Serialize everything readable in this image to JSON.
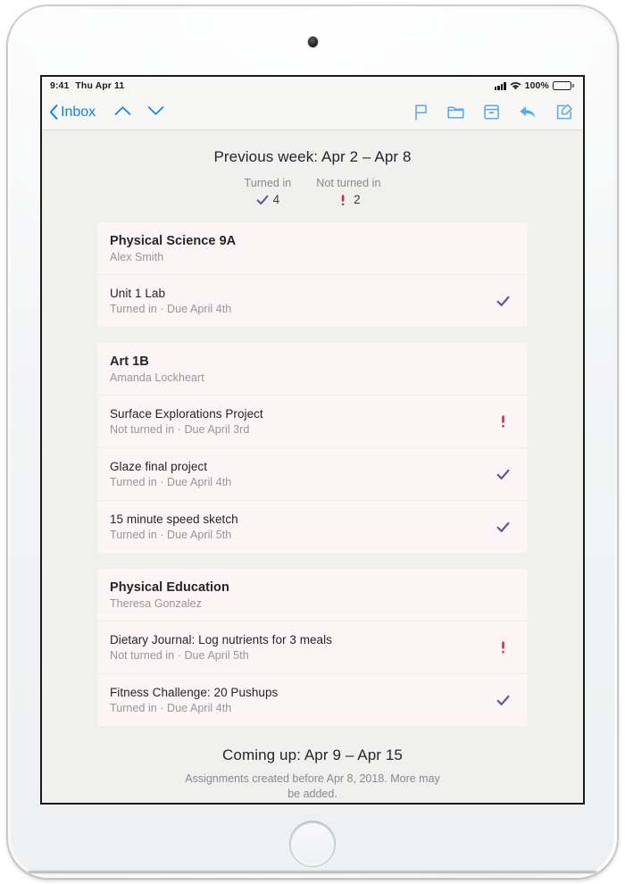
{
  "status_bar": {
    "time": "9:41",
    "date": "Thu Apr 11",
    "battery_percent": "100%",
    "signal_icon": "cellular-signal-icon",
    "wifi_icon": "wifi-icon",
    "battery_icon": "battery-full-icon"
  },
  "nav_bar": {
    "back_label": "Inbox",
    "back_icon": "chevron-left-icon",
    "prev_message_icon": "chevron-up-icon",
    "next_message_icon": "chevron-down-icon",
    "flag_icon": "flag-icon",
    "folder_icon": "folder-icon",
    "archive_icon": "archive-box-icon",
    "reply_icon": "reply-arrow-icon",
    "compose_icon": "compose-icon",
    "accent_color": "#0b82ff"
  },
  "week_header": {
    "title": "Previous week: Apr 2 – Apr 8",
    "summary": [
      {
        "label": "Turned in",
        "value": "4",
        "icon": "checkmark-icon",
        "color": "#5a5a9e"
      },
      {
        "label": "Not turned in",
        "value": "2",
        "icon": "exclamation-icon",
        "color": "#ca2c46"
      }
    ]
  },
  "courses": [
    {
      "name": "Physical Science 9A",
      "teacher": "Alex Smith",
      "assignments": [
        {
          "title": "Unit 1 Lab",
          "meta": "Turned in  ·  Due April 4th",
          "status": "turned-in",
          "status_icon": "checkmark-icon"
        }
      ]
    },
    {
      "name": "Art 1B",
      "teacher": "Amanda Lockheart",
      "assignments": [
        {
          "title": "Surface Explorations Project",
          "meta": "Not turned in  ·  Due April 3rd",
          "status": "not-turned-in",
          "status_icon": "exclamation-icon"
        },
        {
          "title": "Glaze final project",
          "meta": "Turned in  ·  Due April 4th",
          "status": "turned-in",
          "status_icon": "checkmark-icon"
        },
        {
          "title": "15 minute speed sketch",
          "meta": "Turned in  ·  Due April 5th",
          "status": "turned-in",
          "status_icon": "checkmark-icon"
        }
      ]
    },
    {
      "name": "Physical Education",
      "teacher": "Theresa Gonzalez",
      "assignments": [
        {
          "title": "Dietary Journal: Log nutrients for 3 meals",
          "meta": "Not turned in  ·  Due April 5th",
          "status": "not-turned-in",
          "status_icon": "exclamation-icon"
        },
        {
          "title": "Fitness Challenge: 20 Pushups",
          "meta": "Turned in  ·  Due April 4th",
          "status": "turned-in",
          "status_icon": "checkmark-icon"
        }
      ]
    }
  ],
  "footer": {
    "title": "Coming up: Apr 9 – Apr 15",
    "note": "Assignments created before Apr 8, 2018. More may be added."
  },
  "colors": {
    "screen_background": "#f0f0ee",
    "card_background": "#fdf5f5",
    "check_purple": "#5a5a9e",
    "bang_red": "#ca2c46",
    "ios_blue": "#0b82ff"
  }
}
